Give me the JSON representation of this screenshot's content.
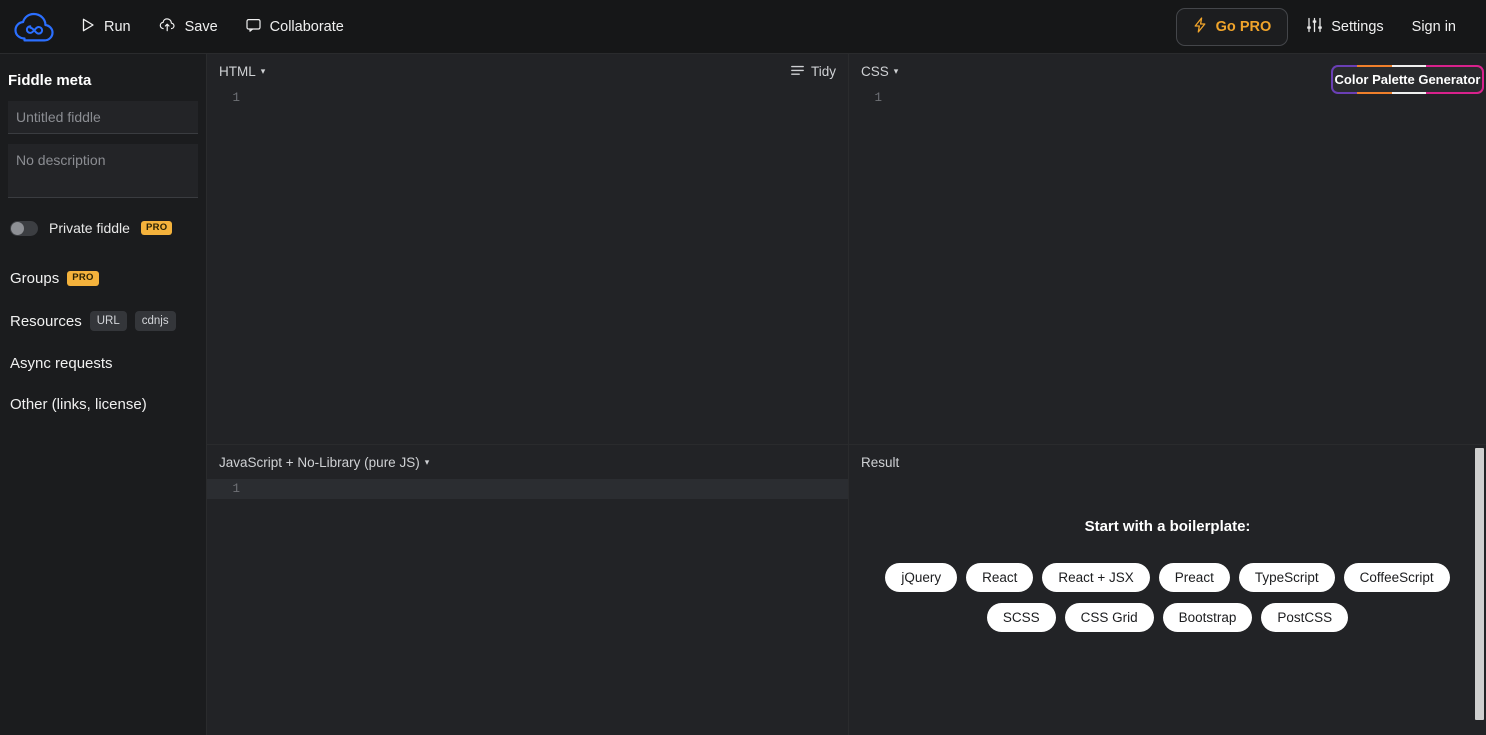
{
  "header": {
    "logo_icon": "cloud-infinity-logo",
    "run_label": "Run",
    "run_icon": "play-icon",
    "save_label": "Save",
    "save_icon": "cloud-upload-icon",
    "collaborate_label": "Collaborate",
    "collaborate_icon": "speech-bubble-icon",
    "gopro_label": "Go PRO",
    "gopro_icon": "lightning-bolt-icon",
    "settings_label": "Settings",
    "settings_icon": "sliders-icon",
    "signin_label": "Sign in",
    "accent_color": "#f0a42b",
    "logo_color": "#2b6fff"
  },
  "sidebar": {
    "title": "Fiddle meta",
    "title_placeholder": "Untitled fiddle",
    "title_value": "",
    "description_placeholder": "No description",
    "description_value": "",
    "private_label": "Private fiddle",
    "private_badge": "PRO",
    "private_enabled": false,
    "groups_label": "Groups",
    "groups_badge": "PRO",
    "resources_label": "Resources",
    "resources_badges": [
      "URL",
      "cdnjs"
    ],
    "async_label": "Async requests",
    "other_label": "Other (links, license)"
  },
  "panels": {
    "html": {
      "title": "HTML",
      "caret": "▾",
      "tidy_label": "Tidy",
      "tidy_icon": "tidy-lines-icon",
      "lines": [
        "1"
      ],
      "content": ""
    },
    "css": {
      "title": "CSS",
      "caret": "▾",
      "lines": [
        "1"
      ],
      "content": ""
    },
    "js": {
      "title": "JavaScript + No-Library (pure JS)",
      "caret": "▾",
      "lines": [
        "1"
      ],
      "content": ""
    },
    "result": {
      "title": "Result",
      "boilerplate_title": "Start with a boilerplate:",
      "boilerplate_row1": [
        "jQuery",
        "React",
        "React + JSX",
        "Preact",
        "TypeScript",
        "CoffeeScript"
      ],
      "boilerplate_row2": [
        "SCSS",
        "CSS Grid",
        "Bootstrap",
        "PostCSS"
      ]
    }
  },
  "palette_badge": {
    "label": "Color Palette Generator",
    "colors": [
      "#6a3fb5",
      "#ef7f2b",
      "#efefef",
      "#d8218c"
    ]
  }
}
